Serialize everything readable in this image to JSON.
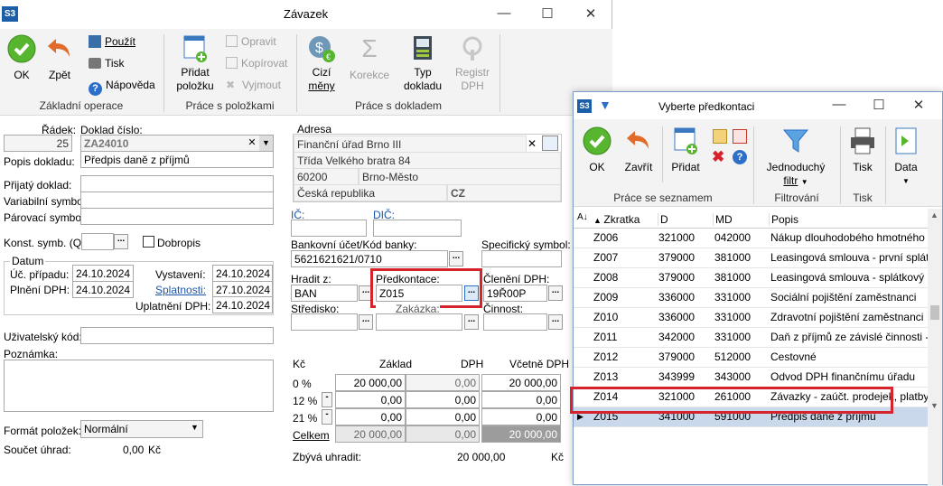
{
  "main_window": {
    "app_icon": "S3",
    "title": "Závazek",
    "ribbon": {
      "ok": "OK",
      "back": "Zpět",
      "use": "Použít",
      "print": "Tisk",
      "help": "Nápověda",
      "group_basic": "Základní operace",
      "add_item_1": "Přidat",
      "add_item_2": "položku",
      "edit": "Opravit",
      "copy": "Kopírovat",
      "cut": "Vyjmout",
      "group_items": "Práce s položkami",
      "foreign_1": "Cizí",
      "foreign_2": "měny",
      "corrections": "Korekce",
      "type_1": "Typ",
      "type_2": "dokladu",
      "register_1": "Registr",
      "register_2": "DPH",
      "group_doc": "Práce s dokladem"
    },
    "form": {
      "row_label": "Řádek:",
      "row_value": "25",
      "doc_no_label": "Doklad číslo:",
      "doc_no_value": "ZA24010",
      "desc_label": "Popis dokladu:",
      "desc_value": "Předpis daně z příjmů",
      "received_label": "Přijatý doklad:",
      "variable_label": "Variabilní symbol:",
      "pairing_label": "Párovací symbol:",
      "const_label": "Konst. symb. (Q):",
      "credit_note_label": "Dobropis",
      "date_group": "Datum",
      "acc_case_label": "Úč. případu:",
      "acc_case_value": "24.10.2024",
      "vat_fulfil_label": "Plnění DPH:",
      "vat_fulfil_value": "24.10.2024",
      "issued_label": "Vystavení:",
      "issued_value": "24.10.2024",
      "due_label": "Splatnosti:",
      "due_value": "27.10.2024",
      "vat_claim_label": "Uplatnění DPH:",
      "vat_claim_value": "24.10.2024",
      "user_code_label": "Uživatelský kód:",
      "note_label": "Poznámka:",
      "format_label": "Formát položek:",
      "format_value": "Normální",
      "sum_label": "Součet úhrad:",
      "sum_value": "0,00",
      "sum_currency": "Kč"
    },
    "address": {
      "label": "Adresa",
      "name": "Finanční úřad Brno III",
      "street": "Třída Velkého bratra  84",
      "zip": "60200",
      "city": "Brno-Město",
      "country": "Česká republika",
      "country_code": "CZ",
      "ic_label": "IČ:",
      "dic_label": "DIČ:",
      "bank_label": "Bankovní účet/Kód banky:",
      "bank_value": "5621621621/0710",
      "spec_label": "Specifický symbol:",
      "pay_label": "Hradit z:",
      "pay_value": "BAN",
      "predkontace_label": "Předkontace:",
      "predkontace_value": "Z015",
      "vat_class_label": "Členění DPH:",
      "vat_class_value": "19Ř00P",
      "center_label": "Středisko:",
      "contract_label": "Zakázka:",
      "activity_label": "Činnost:"
    },
    "totals": {
      "currency": "Kč",
      "col_base": "Základ",
      "col_vat": "DPH",
      "col_total": "Včetně DPH",
      "rows": [
        {
          "rate": "0 %",
          "base": "20 000,00",
          "vat": "0,00",
          "total": "20 000,00"
        },
        {
          "rate": "12 %",
          "base": "0,00",
          "vat": "0,00",
          "total": "0,00"
        },
        {
          "rate": "21 %",
          "base": "0,00",
          "vat": "0,00",
          "total": "0,00"
        },
        {
          "rate": "Celkem",
          "base": "20 000,00",
          "vat": "0,00",
          "total": "20 000,00"
        }
      ],
      "remaining_label": "Zbývá uhradit:",
      "remaining_value": "20 000,00",
      "remaining_currency": "Kč"
    }
  },
  "dialog": {
    "app_icon": "S3",
    "title": "Vyberte předkontaci",
    "ribbon": {
      "ok": "OK",
      "close": "Zavřít",
      "add": "Přidat",
      "group_list": "Práce se seznamem",
      "filter_1": "Jednoduchý",
      "filter_2": "filtr",
      "group_filter": "Filtrování",
      "print": "Tisk",
      "group_print": "Tisk",
      "data": "Data"
    },
    "columns": [
      "Zkratka",
      "D",
      "MD",
      "Popis"
    ],
    "rows": [
      [
        "Z006",
        "321000",
        "042000",
        "Nákup dlouhodobého hmotného maj"
      ],
      [
        "Z007",
        "379000",
        "381000",
        "Leasingová smlouva - první splátka,"
      ],
      [
        "Z008",
        "379000",
        "381000",
        "Leasingová smlouva - splátkový kale"
      ],
      [
        "Z009",
        "336000",
        "331000",
        "Sociální pojištění zaměstnanci"
      ],
      [
        "Z010",
        "336000",
        "331000",
        "Zdravotní pojištění zaměstnanci"
      ],
      [
        "Z011",
        "342000",
        "331000",
        "Daň z příjmů ze závislé činnosti - zálo"
      ],
      [
        "Z012",
        "379000",
        "512000",
        "Cestovné"
      ],
      [
        "Z013",
        "343999",
        "343000",
        "Odvod DPH finančnímu úřadu"
      ],
      [
        "Z014",
        "321000",
        "261000",
        "Závazky - zaúčt. prodejek, platby ka"
      ],
      [
        "Z015",
        "341000",
        "591000",
        "Předpis daně z příjmů"
      ]
    ],
    "selected_index": 9
  }
}
